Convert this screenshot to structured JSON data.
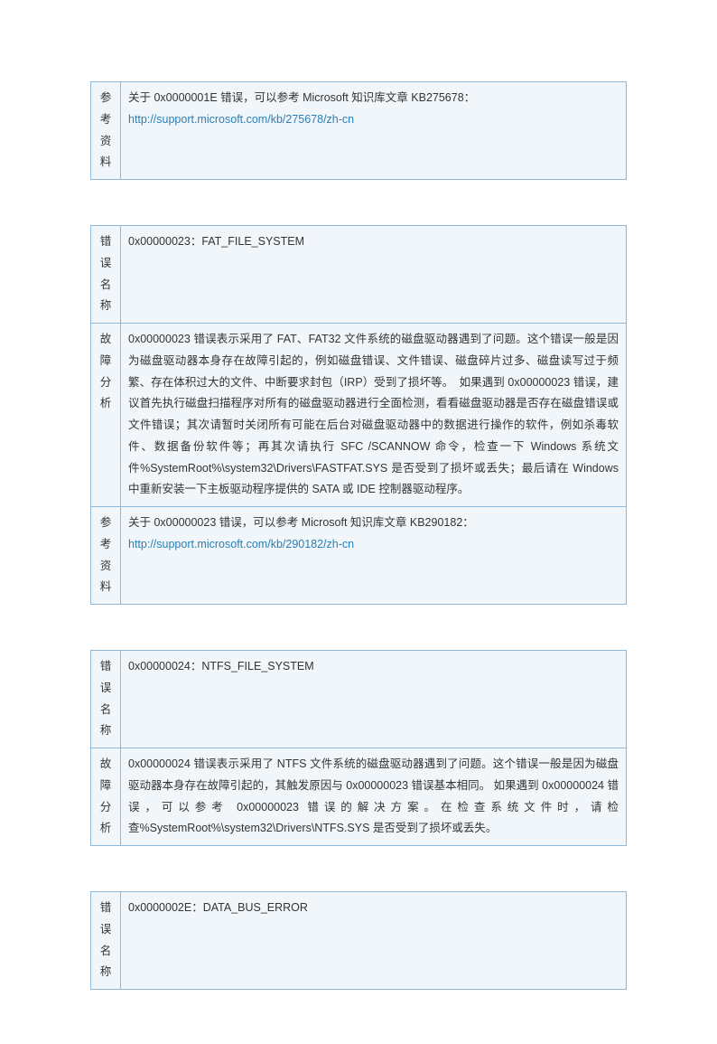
{
  "tables": [
    {
      "rows": [
        {
          "label": "参考资料",
          "text_before_link": "关于 0x0000001E 错误，可以参考 Microsoft 知识库文章 KB275678：",
          "link": "http://support.microsoft.com/kb/275678/zh-cn"
        }
      ]
    },
    {
      "rows": [
        {
          "label": "错误名称",
          "text": "0x00000023：FAT_FILE_SYSTEM"
        },
        {
          "label": "故障分析",
          "text": "0x00000023 错误表示采用了 FAT、FAT32 文件系统的磁盘驱动器遇到了问题。这个错误一般是因为磁盘驱动器本身存在故障引起的，例如磁盘错误、文件错误、磁盘碎片过多、磁盘读写过于频繁、存在体积过大的文件、中断要求封包（IRP）受到了损坏等。　如果遇到 0x00000023 错误，建议首先执行磁盘扫描程序对所有的磁盘驱动器进行全面检测，看看磁盘驱动器是否存在磁盘错误或文件错误；其次请暂时关闭所有可能在后台对磁盘驱动器中的数据进行操作的软件，例如杀毒软件、数据备份软件等；再其次请执行 SFC  /SCANNOW 命令，检查一下 Windows 系统文件%SystemRoot%\\system32\\Drivers\\FASTFAT.SYS 是否受到了损坏或丢失；最后请在 Windows 中重新安装一下主板驱动程序提供的 SATA 或 IDE 控制器驱动程序。"
        },
        {
          "label": "参考资料",
          "text_before_link": "关于 0x00000023 错误，可以参考 Microsoft 知识库文章 KB290182：",
          "link": "http://support.microsoft.com/kb/290182/zh-cn"
        }
      ]
    },
    {
      "rows": [
        {
          "label": "错误名称",
          "text": "0x00000024：NTFS_FILE_SYSTEM"
        },
        {
          "label": "故障分析",
          "text": "0x00000024 错误表示采用了 NTFS 文件系统的磁盘驱动器遇到了问题。这个错误一般是因为磁盘驱动器本身存在故障引起的，其触发原因与 0x00000023 错误基本相同。 如果遇到 0x00000024 错误，可以参考 0x00000023 错误的解决方案。在检查系统文件时，请检查%SystemRoot%\\system32\\Drivers\\NTFS.SYS 是否受到了损坏或丢失。"
        }
      ]
    },
    {
      "rows": [
        {
          "label": "错误名称",
          "text": "0x0000002E：DATA_BUS_ERROR"
        }
      ]
    }
  ]
}
